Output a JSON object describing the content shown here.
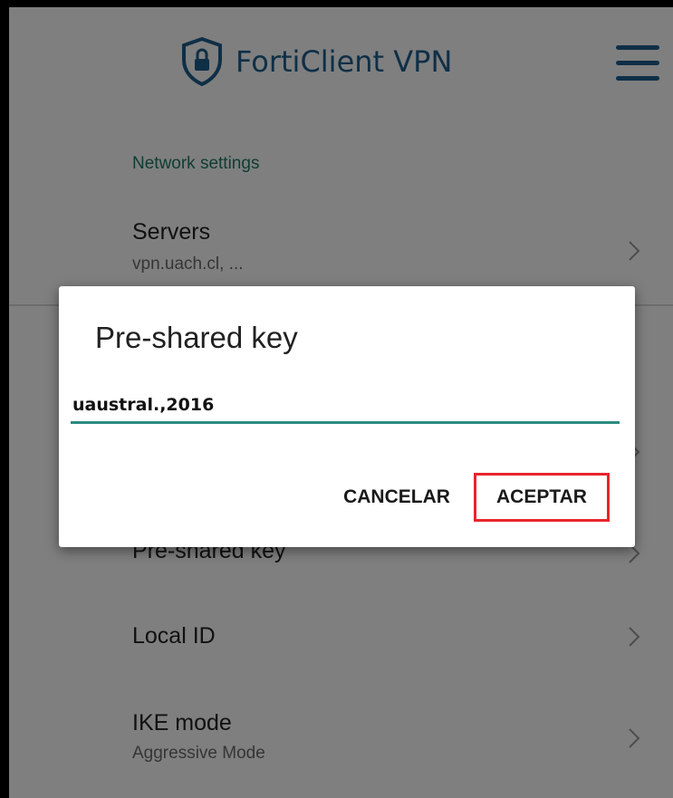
{
  "header": {
    "title": "FortiClient VPN",
    "brand_color": "#1f5f8f",
    "icons": [
      "shield-lock-icon",
      "hamburger-menu-icon"
    ]
  },
  "settings": {
    "section_label": "Network settings",
    "rows": [
      {
        "title": "Servers",
        "subtitle": "vpn.uach.cl, ..."
      },
      {
        "title": "Pre-shared key",
        "subtitle": ""
      },
      {
        "title": "Local ID",
        "subtitle": ""
      },
      {
        "title": "IKE mode",
        "subtitle": "Aggressive Mode"
      }
    ]
  },
  "dialog": {
    "title": "Pre-shared key",
    "input_value": "uaustral.,2016",
    "cancel_label": "CANCELAR",
    "accept_label": "ACEPTAR",
    "accent_color": "#2a8a80",
    "highlight_color": "#e8242c"
  }
}
